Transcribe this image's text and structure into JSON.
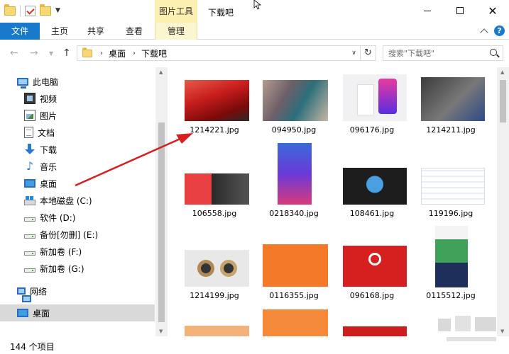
{
  "titlebar": {
    "context_tab": "图片工具",
    "window_title": "下载吧"
  },
  "ribbon": {
    "tabs": [
      "文件",
      "主页",
      "共享",
      "查看",
      "管理"
    ]
  },
  "address": {
    "crumbs": [
      "桌面",
      "下载吧"
    ],
    "search_placeholder": "搜索\"下载吧\""
  },
  "sidebar": {
    "items": [
      {
        "label": "此电脑",
        "icon": "computer-icon"
      },
      {
        "label": "视频",
        "icon": "video-folder-icon"
      },
      {
        "label": "图片",
        "icon": "picture-folder-icon"
      },
      {
        "label": "文档",
        "icon": "document-folder-icon"
      },
      {
        "label": "下载",
        "icon": "download-folder-icon"
      },
      {
        "label": "音乐",
        "icon": "music-folder-icon"
      },
      {
        "label": "桌面",
        "icon": "desktop-folder-icon"
      },
      {
        "label": "本地磁盘 (C:)",
        "icon": "system-drive-icon"
      },
      {
        "label": "软件 (D:)",
        "icon": "drive-icon"
      },
      {
        "label": "备份[勿删] (E:)",
        "icon": "drive-icon"
      },
      {
        "label": "新加卷 (F:)",
        "icon": "drive-icon"
      },
      {
        "label": "新加卷 (G:)",
        "icon": "drive-icon"
      },
      {
        "label": "网络",
        "icon": "network-icon"
      },
      {
        "label": "桌面",
        "icon": "desktop-icon"
      }
    ]
  },
  "files": [
    {
      "name": "1214221.jpg"
    },
    {
      "name": "094950.jpg"
    },
    {
      "name": "096176.jpg"
    },
    {
      "name": "1214211.jpg"
    },
    {
      "name": "106558.jpg"
    },
    {
      "name": "0218340.jpg"
    },
    {
      "name": "108461.jpg"
    },
    {
      "name": "119196.jpg"
    },
    {
      "name": "1214199.jpg"
    },
    {
      "name": "0116355.jpg"
    },
    {
      "name": "096168.jpg"
    },
    {
      "name": "0115512.jpg"
    }
  ],
  "status": {
    "item_count": "144 个项目"
  },
  "colors": {
    "accent": "#1979ca",
    "context_tab": "#fbf0b0",
    "selected_row": "#d9d9d9",
    "arrow": "#d42020"
  }
}
